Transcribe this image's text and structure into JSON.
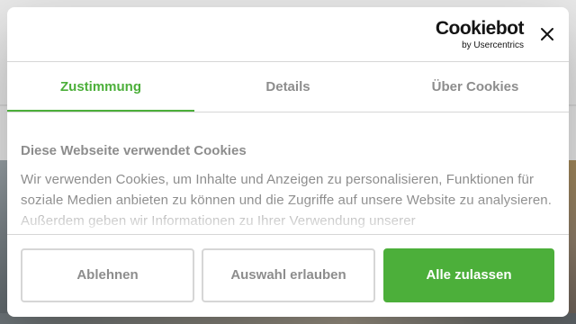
{
  "colors": {
    "accent": "#4caf3a",
    "tab_text": "#141414",
    "muted_text": "#8d8d8d",
    "border": "#d6d6d6",
    "primary_button_bg": "#4caf3a"
  },
  "header": {
    "logo_text": "Cookiebot",
    "logo_subtext": "by Usercentrics",
    "close_icon": "close-icon"
  },
  "tabs": [
    {
      "label": "Zustimmung",
      "active": true
    },
    {
      "label": "Details",
      "active": false
    },
    {
      "label": "Über Cookies",
      "active": false
    }
  ],
  "content": {
    "title": "Diese Webseite verwendet Cookies",
    "body": "Wir verwenden Cookies, um Inhalte und Anzeigen zu personalisieren, Funktionen für soziale Medien anbieten zu können und die Zugriffe auf unsere Website zu analysieren. Außerdem geben wir Informationen zu Ihrer Verwendung unserer"
  },
  "buttons": {
    "decline": "Ablehnen",
    "allow_selection": "Auswahl erlauben",
    "allow_all": "Alle zulassen"
  }
}
